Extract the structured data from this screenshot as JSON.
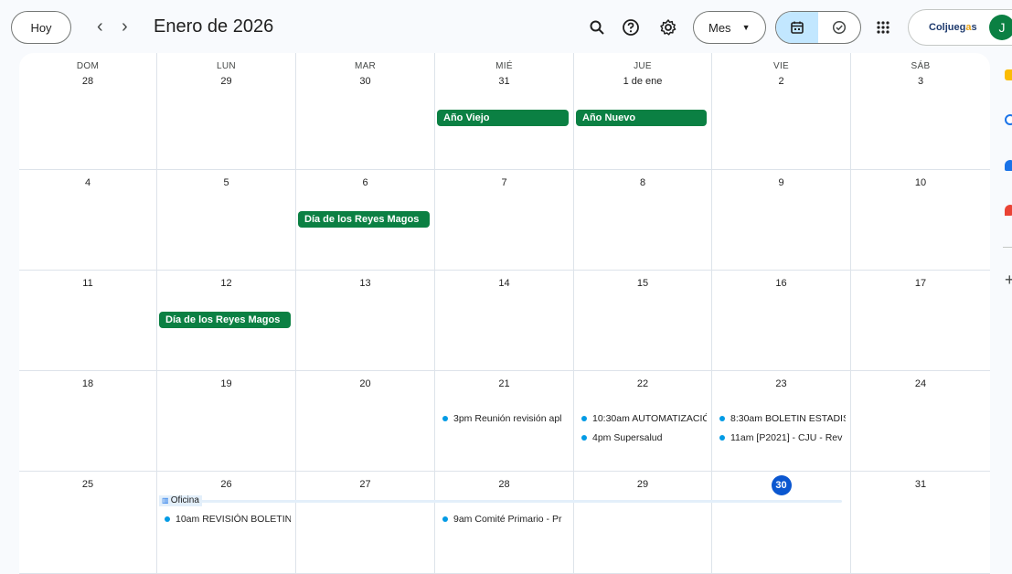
{
  "header": {
    "today_label": "Hoy",
    "prev_label": "‹",
    "next_label": "›",
    "title": "Enero de 2026",
    "view_label": "Mes",
    "account_org": "Coljueg",
    "account_org_highlight": "a",
    "account_org_end": "s",
    "avatar_letter": "J"
  },
  "icons": {
    "search": "search-icon",
    "help": "help-icon",
    "settings": "gear-icon",
    "calendar_view": "calendar-icon",
    "tasks_view": "task-check-icon",
    "apps": "apps-grid-icon"
  },
  "calendar": {
    "weekdays": [
      "DOM",
      "LUN",
      "MAR",
      "MIÉ",
      "JUE",
      "VIE",
      "SÁB"
    ],
    "weeks": [
      [
        "28",
        "29",
        "30",
        "31",
        "1 de ene",
        "2",
        "3"
      ],
      [
        "4",
        "5",
        "6",
        "7",
        "8",
        "9",
        "10"
      ],
      [
        "11",
        "12",
        "13",
        "14",
        "15",
        "16",
        "17"
      ],
      [
        "18",
        "19",
        "20",
        "21",
        "22",
        "23",
        "24"
      ],
      [
        "25",
        "26",
        "27",
        "28",
        "29",
        "30",
        "31"
      ]
    ],
    "today": "30",
    "holidays": [
      {
        "label": "Año Viejo",
        "week": 0,
        "col": 3
      },
      {
        "label": "Año Nuevo",
        "week": 0,
        "col": 4
      },
      {
        "label": "Día de los Reyes Magos",
        "week": 1,
        "col": 2
      },
      {
        "label": "Día de los Reyes Magos",
        "week": 2,
        "col": 1
      }
    ],
    "events": [
      {
        "time": "3pm",
        "title": "Reunión revisión apl",
        "week": 3,
        "col": 3,
        "slot": 0
      },
      {
        "time": "10:30am",
        "title": "AUTOMATIZACIÓ",
        "week": 3,
        "col": 4,
        "slot": 0
      },
      {
        "time": "4pm",
        "title": "Supersalud",
        "week": 3,
        "col": 4,
        "slot": 1
      },
      {
        "time": "8:30am",
        "title": "BOLETIN ESTADIS",
        "week": 3,
        "col": 5,
        "slot": 0
      },
      {
        "time": "11am",
        "title": "[P2021] - CJU - Rev",
        "week": 3,
        "col": 5,
        "slot": 1
      },
      {
        "time": "10am",
        "title": "REVISIÓN BOLETIN",
        "week": 4,
        "col": 1,
        "slot": 0
      },
      {
        "time": "9am",
        "title": "Comité Primario - Pr",
        "week": 4,
        "col": 3,
        "slot": 0
      }
    ],
    "working_location": {
      "label": "Oficina",
      "week": 4,
      "col_start": 1,
      "col_end": 5
    }
  },
  "colors": {
    "holiday": "#0b8043",
    "event_dot": "#039be5",
    "today": "#0b57d0",
    "active_view": "#c2e7ff"
  }
}
